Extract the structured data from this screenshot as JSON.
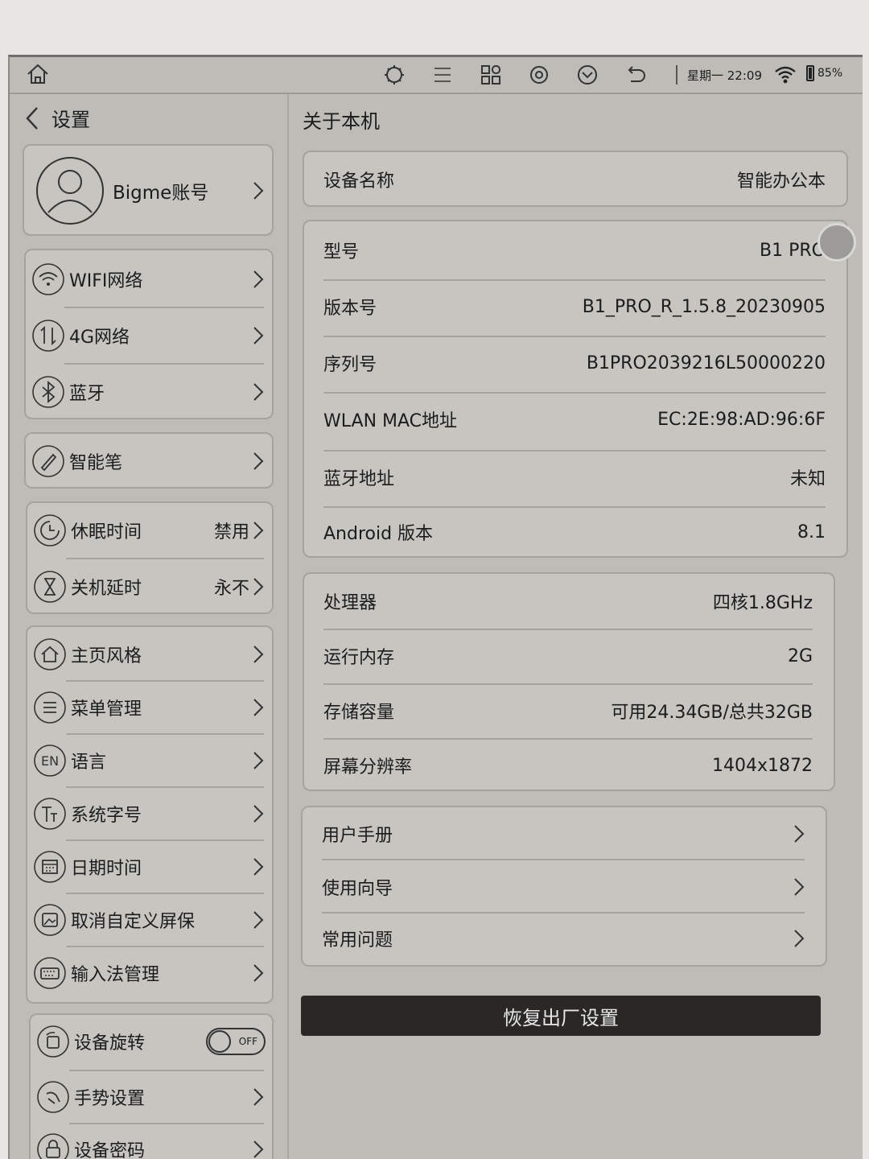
{
  "status_bar": {
    "time": "星期一 22:09",
    "battery": "85%",
    "battery_level": 0.85,
    "icons": [
      "home-icon",
      "refresh-icon",
      "menu-icon",
      "apps-icon",
      "settings-icon",
      "down-icon",
      "back-icon",
      "wifi-icon",
      "battery-icon"
    ]
  },
  "left": {
    "back_title": "设置",
    "account_label": "Bigme账号",
    "groups": {
      "network": [
        {
          "label": "WIFI网络"
        },
        {
          "label": "4G网络"
        },
        {
          "label": "蓝牙"
        }
      ],
      "pen": [
        {
          "label": "智能笔"
        }
      ],
      "power": [
        {
          "label": "休眠时间",
          "value": "禁用"
        },
        {
          "label": "关机延时",
          "value": "永不"
        }
      ],
      "system": [
        {
          "label": "主页风格"
        },
        {
          "label": "菜单管理"
        },
        {
          "label": "语言"
        },
        {
          "label": "系统字号"
        },
        {
          "label": "日期时间"
        },
        {
          "label": "取消自定义屏保"
        },
        {
          "label": "输入法管理"
        }
      ],
      "device": [
        {
          "label": "设备旋转",
          "toggle": "OFF"
        },
        {
          "label": "手势设置"
        },
        {
          "label": "设备密码"
        }
      ]
    },
    "lang_icon_text": "EN"
  },
  "right": {
    "title": "关于本机",
    "device_name": {
      "key": "设备名称",
      "value": "智能办公本"
    },
    "info": [
      {
        "key": "型号",
        "value": "B1 PRO"
      },
      {
        "key": "版本号",
        "value": "B1_PRO_R_1.5.8_20230905"
      },
      {
        "key": "序列号",
        "value": "B1PRO2039216L50000220"
      },
      {
        "key": "WLAN MAC地址",
        "value": "EC:2E:98:AD:96:6F"
      },
      {
        "key": "蓝牙地址",
        "value": "未知"
      },
      {
        "key": "Android 版本",
        "value": "8.1"
      }
    ],
    "hardware": [
      {
        "key": "处理器",
        "value": "四核1.8GHz"
      },
      {
        "key": "运行内存",
        "value": "2G"
      },
      {
        "key": "存储容量",
        "value": "可用24.34GB/总共32GB"
      },
      {
        "key": "屏幕分辨率",
        "value": "1404x1872"
      }
    ],
    "help": [
      {
        "key": "用户手册"
      },
      {
        "key": "使用向导"
      },
      {
        "key": "常用问题"
      }
    ],
    "reset_label": "恢复出厂设置"
  }
}
